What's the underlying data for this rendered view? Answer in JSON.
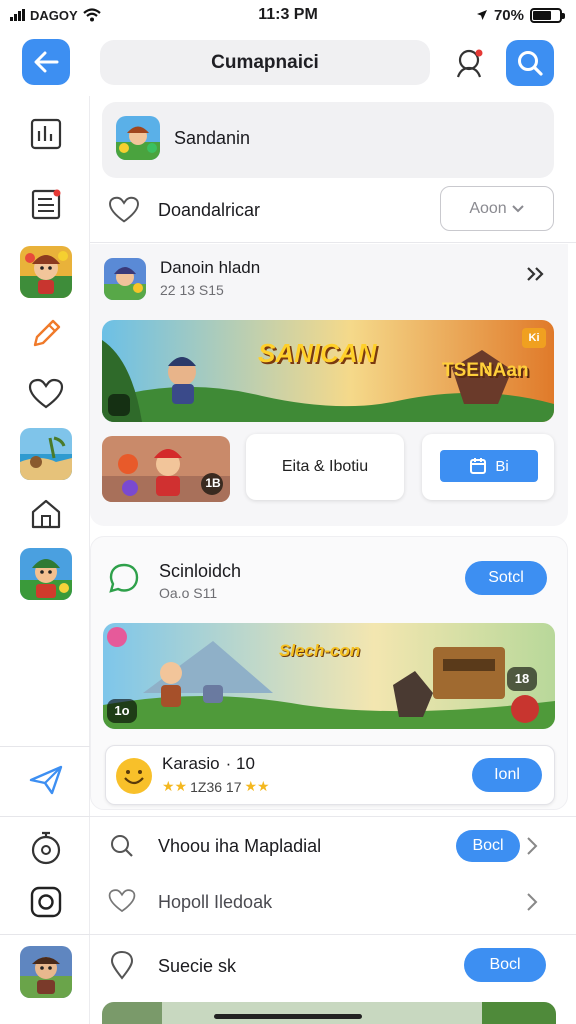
{
  "status_bar": {
    "carrier": "DAGOY",
    "time": "11:3 PM",
    "battery": "70%",
    "battery_level": 0.7
  },
  "header": {
    "title": "Cumapnaici"
  },
  "featured": {
    "name": "Sandanin"
  },
  "favorite_row": {
    "label": "Doandalricar",
    "dropdown_label": "Aoon"
  },
  "game_card": {
    "title": "Danoin hladn",
    "subtitle": "22 13 S15",
    "banner_title": "SANICAN",
    "banner_subtitle": "TSENAan",
    "banner_badge": "Ki",
    "tile_badge": "1B",
    "tile_middle": "Eita & Ibotiu",
    "tile_button": "Bi"
  },
  "section_two": {
    "title": "Scinloidch",
    "subtitle": "Oa.o S11",
    "button": "Sotcl",
    "banner_title": "Slech-con",
    "badge_left": "1o",
    "badge_right": "18"
  },
  "rating_card": {
    "name": "Karasio",
    "name_suffix": "· 10",
    "rating_text": "1Z36 17",
    "button": "Ionl"
  },
  "list": [
    {
      "label": "Vhoou iha Mapladial",
      "button": "Bocl"
    },
    {
      "label": "Hopoll Iledoak",
      "button": ""
    },
    {
      "label": "Suecie sk",
      "button": "Bocl"
    }
  ],
  "colors": {
    "accent": "#3d8ff2",
    "pill_bg": "#f0f0f2",
    "separator": "#e8e8ec"
  },
  "icons": [
    "back-arrow-icon",
    "profile-icon",
    "search-icon",
    "chart-icon",
    "document-icon",
    "pencil-icon",
    "heart-icon",
    "home-icon",
    "send-icon",
    "timer-icon",
    "instagram-icon"
  ]
}
